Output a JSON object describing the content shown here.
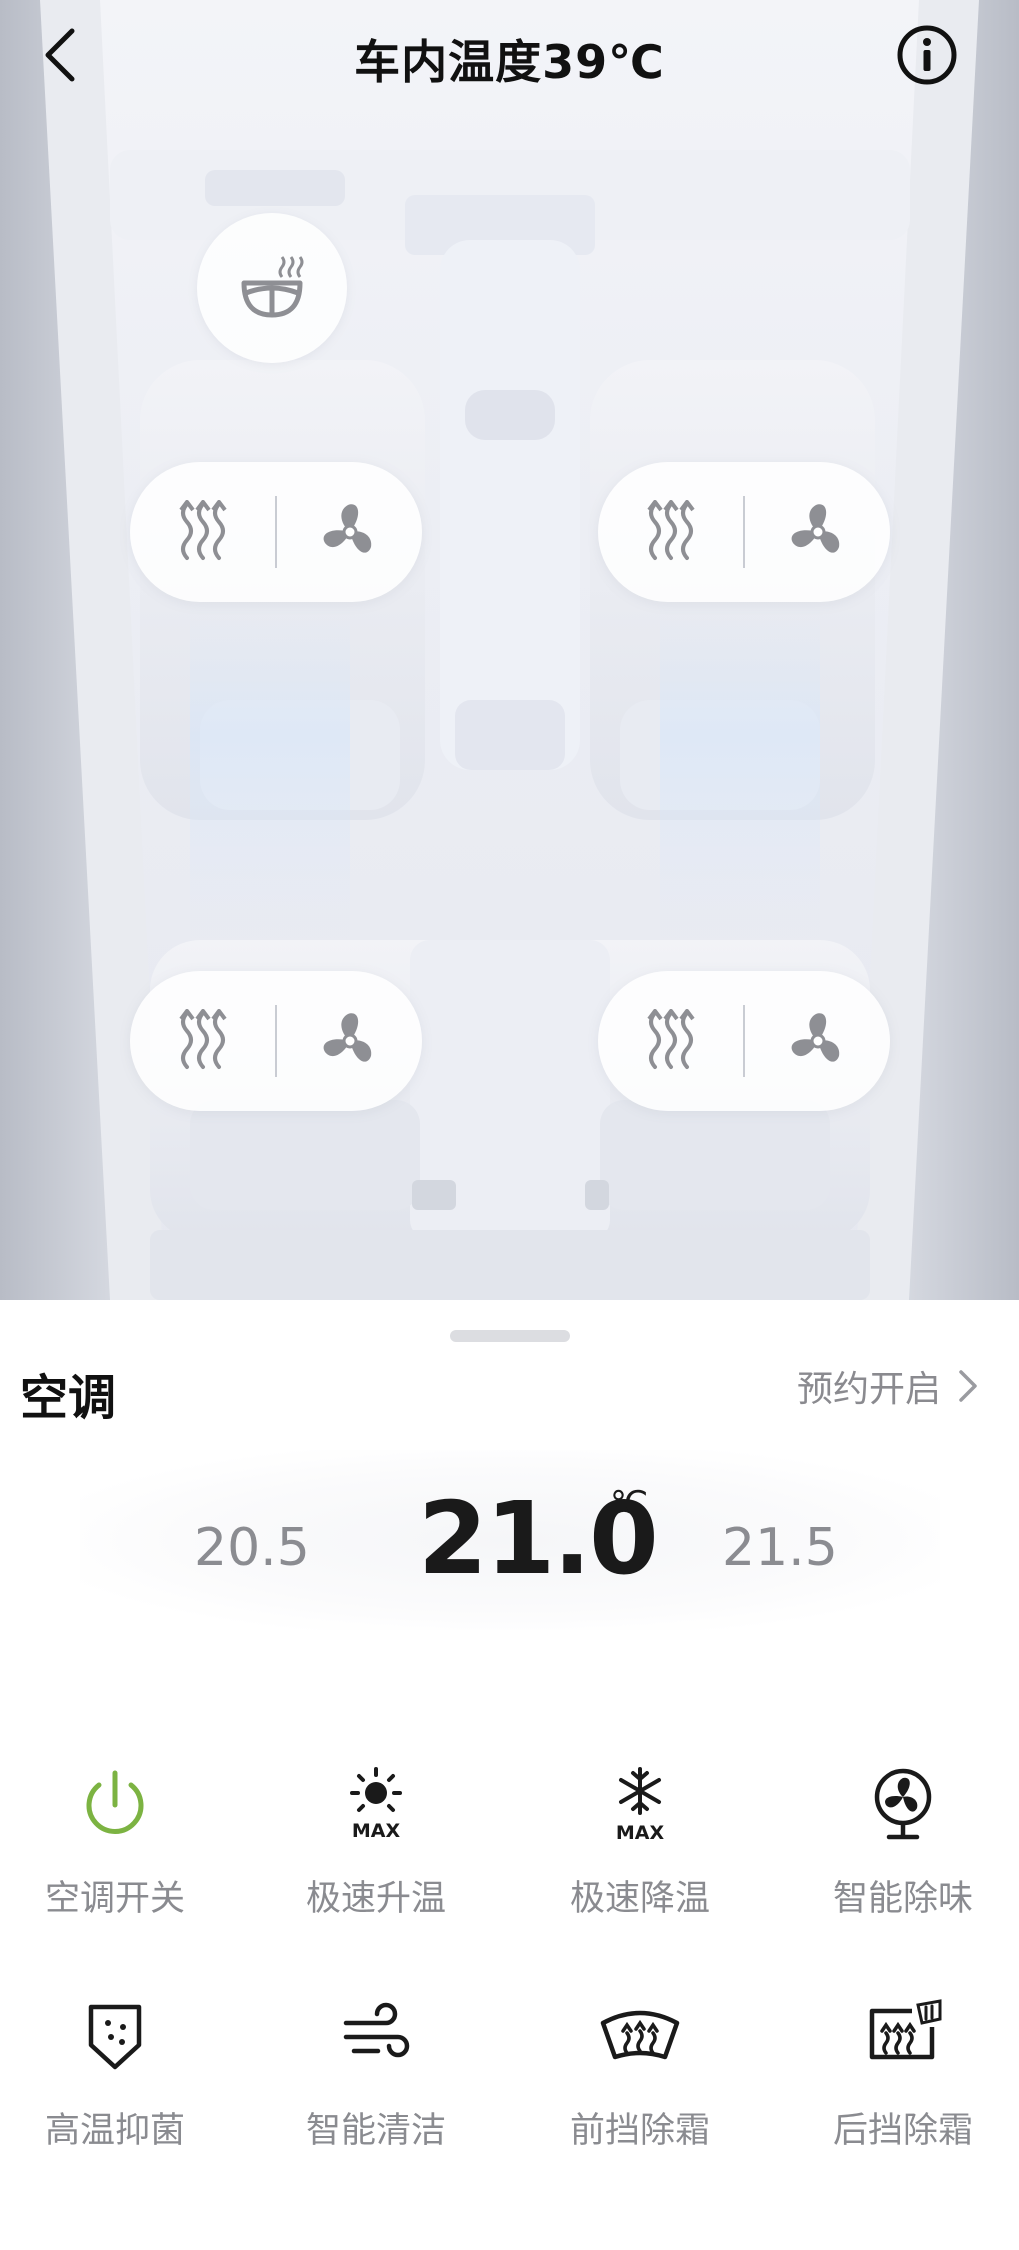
{
  "header": {
    "title": "车内温度39℃"
  },
  "climate": {
    "section_title": "空调",
    "schedule_label": "预约开启",
    "temperature": {
      "current": "21.0",
      "unit": "℃",
      "lower_option": "20.5",
      "upper_option": "21.5"
    }
  },
  "functions": [
    {
      "label": "空调开关",
      "icon": "power-icon"
    },
    {
      "label": "极速升温",
      "icon": "sun-max-icon"
    },
    {
      "label": "极速降温",
      "icon": "snowflake-max-icon"
    },
    {
      "label": "智能除味",
      "icon": "fan-icon"
    },
    {
      "label": "高温抑菌",
      "icon": "shield-icon"
    },
    {
      "label": "智能清洁",
      "icon": "wind-icon"
    },
    {
      "label": "前挡除霜",
      "icon": "front-defrost-icon"
    },
    {
      "label": "后挡除霜",
      "icon": "rear-defrost-icon"
    }
  ],
  "seats": [
    {
      "position": "front-left",
      "controls": [
        "seat-heat-icon",
        "seat-vent-icon"
      ]
    },
    {
      "position": "front-right",
      "controls": [
        "seat-heat-icon",
        "seat-vent-icon"
      ]
    },
    {
      "position": "rear-left",
      "controls": [
        "seat-heat-icon",
        "seat-vent-icon"
      ]
    },
    {
      "position": "rear-right",
      "controls": [
        "seat-heat-icon",
        "seat-vent-icon"
      ]
    }
  ],
  "icons": {
    "max_text": "MAX"
  },
  "colors": {
    "power_on": "#7cb342",
    "icon_gray": "#8e8f94",
    "icon_dark": "#1a1a1a",
    "label_gray": "#8a8b90"
  }
}
